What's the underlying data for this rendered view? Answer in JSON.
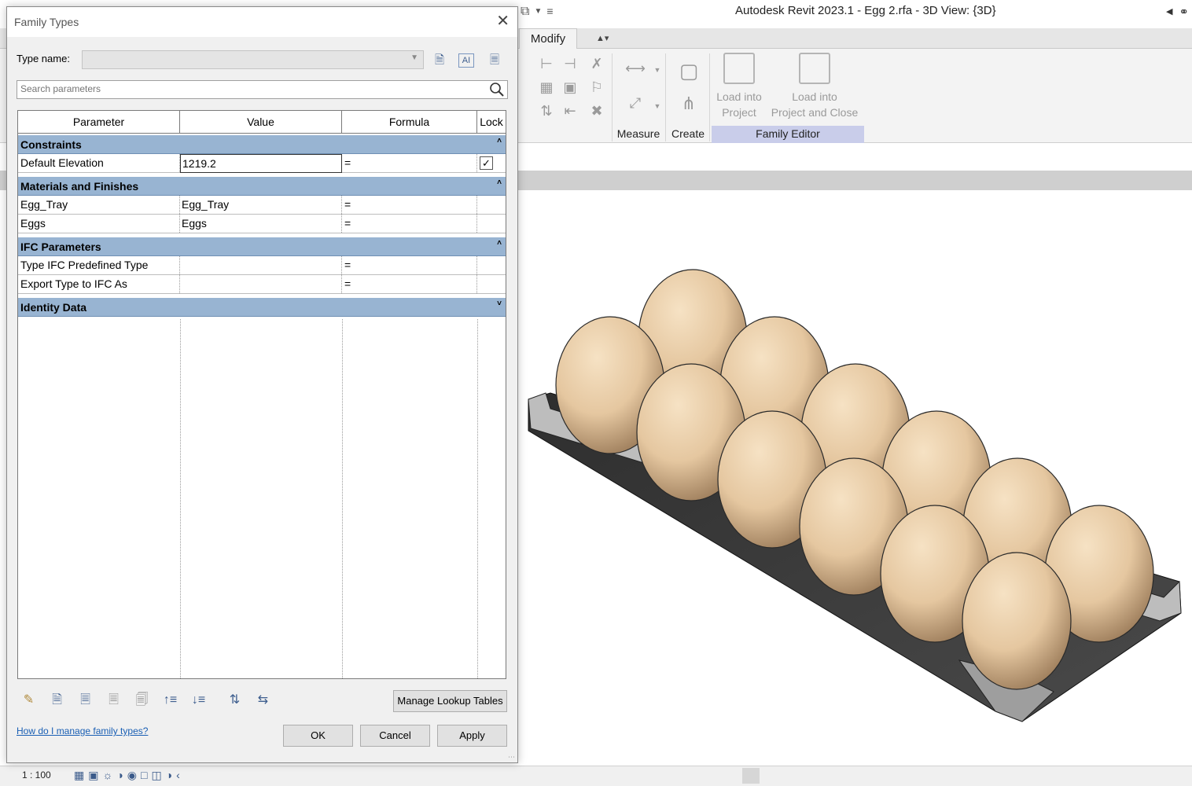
{
  "app": {
    "title": "Autodesk Revit 2023.1 - Egg 2.rfa - 3D View: {3D}",
    "tabs": {
      "modify": "Modify"
    },
    "ribbon": {
      "panels": {
        "measure": "Measure",
        "create": "Create",
        "family_editor": "Family Editor"
      },
      "load_into_project": "Load into\nProject",
      "load_into_project_close": "Load into\nProject and Close"
    },
    "status": {
      "scale": "1 : 100"
    }
  },
  "dialog": {
    "title": "Family Types",
    "type_name_label": "Type name:",
    "search_placeholder": "Search parameters",
    "columns": {
      "parameter": "Parameter",
      "value": "Value",
      "formula": "Formula",
      "lock": "Lock"
    },
    "groups": {
      "constraints": {
        "name": "Constraints",
        "rows": [
          {
            "parameter": "Default Elevation",
            "value": "1219.2",
            "formula": "=",
            "locked": true
          }
        ]
      },
      "materials": {
        "name": "Materials and Finishes",
        "rows": [
          {
            "parameter": "Egg_Tray",
            "value": "Egg_Tray",
            "formula": "="
          },
          {
            "parameter": "Eggs",
            "value": "Eggs",
            "formula": "="
          }
        ]
      },
      "ifc": {
        "name": "IFC Parameters",
        "rows": [
          {
            "parameter": "Type IFC Predefined Type",
            "value": "",
            "formula": "="
          },
          {
            "parameter": "Export Type to IFC As",
            "value": "",
            "formula": "="
          }
        ]
      },
      "identity": {
        "name": "Identity Data"
      }
    },
    "buttons": {
      "manage_lookup": "Manage Lookup Tables",
      "ok": "OK",
      "cancel": "Cancel",
      "apply": "Apply"
    },
    "help_link": "How do I manage family types?"
  },
  "colors": {
    "group_header": "#98b4d2",
    "egg_fill": "#e7c9a3",
    "tray": "#3a3a3a",
    "link": "#1a5fb4"
  }
}
